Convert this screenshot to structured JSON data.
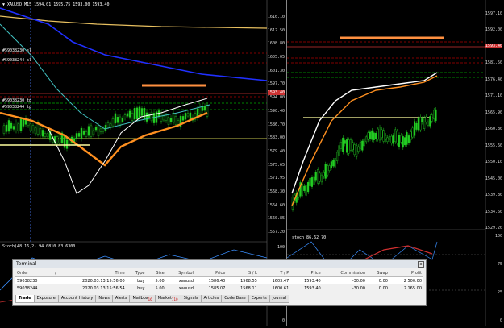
{
  "chartA": {
    "title": "▼ XAUUSD,M15  1594.01 1595.75 1593.00 1593.40",
    "price_labels": [
      "1616.10",
      "1612.50",
      "1608.80",
      "1605.05",
      "1601.30",
      "1597.70",
      "1594.00",
      "1590.40",
      "1586.70",
      "1583.00",
      "1579.40",
      "1575.65",
      "1571.95",
      "1568.30",
      "1564.60",
      "1560.85",
      "1557.20"
    ],
    "order_labels": [
      "#59038230 sl",
      "#59038244 sl",
      "#59038230 tp",
      "#59038244 tp"
    ],
    "bid_label": "1593.40",
    "stoch_label": "Stoch(48,16,2) 94.0810 83.6300",
    "stoch_levels": [
      "100",
      "0"
    ]
  },
  "chartB": {
    "price_labels": [
      "1597.10",
      "1592.00",
      "1586.90",
      "1581.50",
      "1576.40",
      "1571.10",
      "1565.90",
      "1560.80",
      "1555.60",
      "1550.10",
      "1545.00",
      "1539.80",
      "1534.60",
      "1529.20"
    ],
    "bid_label": "1593.40",
    "stoch_label": "stoch 86.62 70",
    "stoch_levels": [
      "100",
      "75",
      "25",
      "0"
    ]
  },
  "terminal": {
    "title": "Terminal",
    "columns": [
      "Order",
      "/",
      "Time",
      "Type",
      "Size",
      "Symbol",
      "Price",
      "S / L",
      "T / P",
      "Price",
      "Commission",
      "Swap",
      "Profit"
    ],
    "rows": [
      [
        "59038230",
        "2020.03.13 15:56:00",
        "buy",
        "5.00",
        "xauusd",
        "1586.40",
        "1568.55",
        "1603.47",
        "1593.40",
        "-30.00",
        "0.00",
        "2 500.00"
      ],
      [
        "59038244",
        "2020.03.13 15:56:54",
        "buy",
        "5.00",
        "xauusd",
        "1585.07",
        "1568.11",
        "1600.61",
        "1593.40",
        "-30.00",
        "0.00",
        "2 165.00"
      ]
    ],
    "tabs": [
      {
        "label": "Trade",
        "badge": ""
      },
      {
        "label": "Exposure",
        "badge": ""
      },
      {
        "label": "Account History",
        "badge": ""
      },
      {
        "label": "News",
        "badge": ""
      },
      {
        "label": "Alerts",
        "badge": ""
      },
      {
        "label": "Mailbox",
        "badge": "16"
      },
      {
        "label": "Market",
        "badge": "110"
      },
      {
        "label": "Signals",
        "badge": ""
      },
      {
        "label": "Articles",
        "badge": ""
      },
      {
        "label": "Code Base",
        "badge": ""
      },
      {
        "label": "Experts",
        "badge": ""
      },
      {
        "label": "Journal",
        "badge": ""
      }
    ],
    "close_glyph": "x"
  }
}
